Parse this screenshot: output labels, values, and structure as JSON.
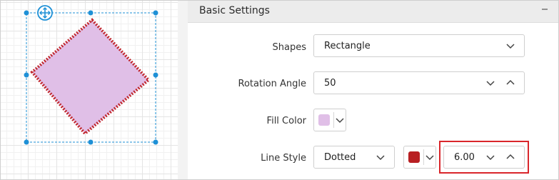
{
  "canvas": {
    "shape_fill": "#e0bfe7",
    "shape_stroke": "#c0262d",
    "handle_color": "#1e90d6"
  },
  "panel": {
    "title": "Basic Settings",
    "collapse_icon": "minus-icon"
  },
  "settings": {
    "shapes": {
      "label": "Shapes",
      "value": "Rectangle"
    },
    "rotation": {
      "label": "Rotation Angle",
      "value": "50"
    },
    "fill": {
      "label": "Fill Color",
      "color": "#e0bfe7"
    },
    "line_style": {
      "label": "Line Style",
      "value": "Dotted",
      "color": "#b81f22",
      "width": "6.00"
    }
  }
}
